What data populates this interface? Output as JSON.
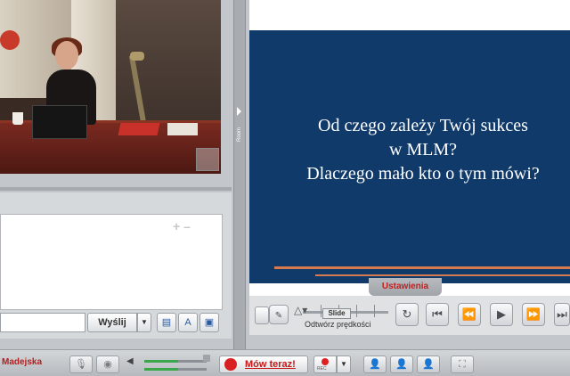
{
  "chat": {
    "send_label": "Wyślij",
    "send_dropdown_icon": "chevron-down-icon",
    "zoom_in_label": "+",
    "zoom_out_label": "–",
    "font_tool_label": "A"
  },
  "presentation": {
    "title_line1": "Od czego zależy Twój  sukces",
    "title_line2": "w MLM?",
    "title_line3": "Dlaczego mało kto o tym mówi?",
    "slide_bg": "#103a6a",
    "accent_line_color": "#d77a4e",
    "settings_tab": "Ustawienia",
    "speed_label": "Odtwórz prędkości",
    "slide_tag": "Slide"
  },
  "splitter": {
    "label": "Room"
  },
  "bottom": {
    "user_name": "Madejska",
    "speak_label": "Mów teraz!",
    "rec_label": "REC",
    "accent_red": "#c81818"
  }
}
